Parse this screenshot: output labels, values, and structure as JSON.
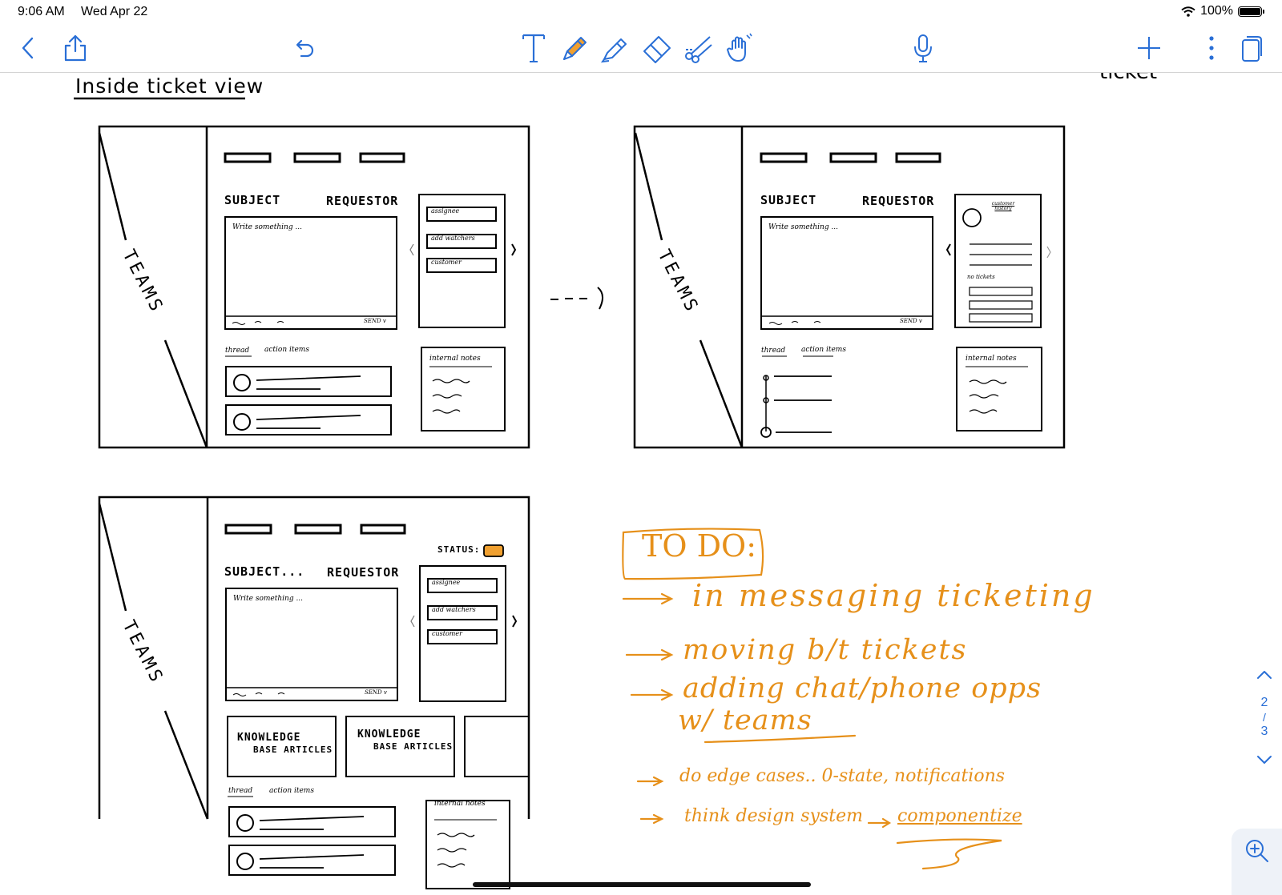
{
  "status_bar": {
    "time": "9:06 AM",
    "date": "Wed Apr 22",
    "battery": "100%"
  },
  "toolbar": {
    "icons": [
      "back-icon",
      "share-icon",
      "undo-icon",
      "text-tool-icon",
      "pencil-icon",
      "highlighter-icon",
      "eraser-icon",
      "scissors-icon",
      "hand-tool-icon",
      "microphone-icon",
      "add-icon",
      "more-icon",
      "pages-icon"
    ],
    "accent": "#2a6fd6",
    "pencil_color": "#f0a030"
  },
  "sketch": {
    "section_title": "Inside ticket view",
    "top_right_fragment": "ticket",
    "wireframe1": {
      "sidebar": "TEAMS",
      "subject": "SUBJECT",
      "requestor": "REQUESTOR",
      "placeholder": "Write something ...",
      "send": "SEND v",
      "fields": [
        "assignee",
        "add watchers",
        "customer"
      ],
      "tabs": [
        "thread",
        "action items"
      ],
      "notes": "internal notes"
    },
    "arrow": "---›",
    "wireframe2": {
      "sidebar": "TEAMS",
      "subject": "SUBJECT",
      "requestor": "REQUESTOR",
      "placeholder": "Write something ...",
      "send": "SEND v",
      "history_title": "customer history",
      "no_tickets": "no tickets",
      "tabs": [
        "thread",
        "action items"
      ],
      "notes": "internal notes"
    },
    "wireframe3": {
      "sidebar": "TEAMS",
      "status": "STATUS:",
      "subject": "SUBJECT...",
      "requestor": "REQUESTOR",
      "placeholder": "Write something ...",
      "send": "SEND v",
      "fields": [
        "assignee",
        "add watchers",
        "customer"
      ],
      "kb1": [
        "KNOWLEDGE",
        "BASE ARTICLES"
      ],
      "kb2": [
        "KNOWLEDGE",
        "BASE ARTICLES"
      ],
      "tabs": [
        "thread",
        "action items"
      ],
      "notes": "internal notes"
    },
    "todo": {
      "title": "TO DO:",
      "items": [
        "in messaging ticketing",
        "moving b/t tickets",
        "adding chat/phone opps",
        "w/ teams",
        "do edge cases.. 0-state, notifications",
        "think design system",
        "componentize"
      ],
      "color": "#e6901a"
    }
  },
  "page_nav": {
    "current": "2",
    "separator": "/",
    "total": "3"
  }
}
